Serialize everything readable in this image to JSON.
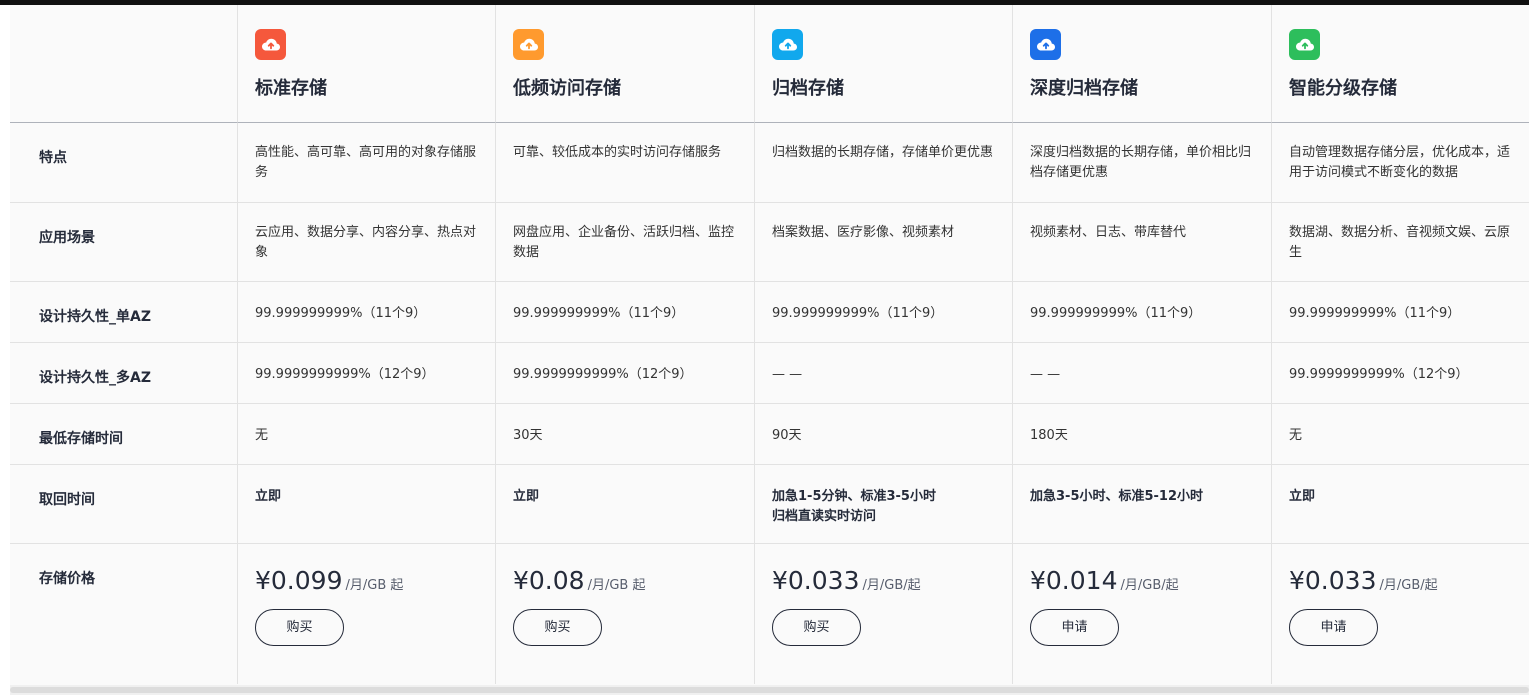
{
  "products": [
    {
      "name": "标准存储",
      "icon": "cloud-upload-icon",
      "color": "#f5583c"
    },
    {
      "name": "低频访问存储",
      "icon": "cloud-upload-icon",
      "color": "#ff9a2e"
    },
    {
      "name": "归档存储",
      "icon": "cloud-upload-icon",
      "color": "#11a8ed"
    },
    {
      "name": "深度归档存储",
      "icon": "cloud-upload-icon",
      "color": "#1d6fe8"
    },
    {
      "name": "智能分级存储",
      "icon": "cloud-upload-icon",
      "color": "#2dbe5c"
    }
  ],
  "rows": [
    {
      "label": "特点",
      "values": [
        "高性能、高可靠、高可用的对象存储服务",
        "可靠、较低成本的实时访问存储服务",
        "归档数据的长期存储，存储单价更优惠",
        "深度归档数据的长期存储，单价相比归档存储更优惠",
        "自动管理数据存储分层，优化成本，适用于访问模式不断变化的数据"
      ]
    },
    {
      "label": "应用场景",
      "values": [
        "云应用、数据分享、内容分享、热点对象",
        "网盘应用、企业备份、活跃归档、监控数据",
        "档案数据、医疗影像、视频素材",
        "视频素材、日志、带库替代",
        "数据湖、数据分析、音视频文娱、云原生"
      ]
    },
    {
      "label": "设计持久性_单AZ",
      "values": [
        "99.999999999%（11个9）",
        "99.999999999%（11个9）",
        "99.999999999%（11个9）",
        "99.999999999%（11个9）",
        "99.999999999%（11个9）"
      ]
    },
    {
      "label": "设计持久性_多AZ",
      "values": [
        "99.9999999999%（12个9）",
        "99.9999999999%（12个9）",
        "— —",
        "— —",
        "99.9999999999%（12个9）"
      ]
    },
    {
      "label": "最低存储时间",
      "values": [
        "无",
        "30天",
        "90天",
        "180天",
        "无"
      ]
    },
    {
      "label": "取回时间",
      "values": [
        "立即",
        "立即",
        "加急1-5分钟、标准3-5小时\n归档直读实时访问",
        "加急3-5小时、标准5-12小时",
        "立即"
      ]
    }
  ],
  "price_row": {
    "label": "存储价格",
    "items": [
      {
        "amount": "¥0.099",
        "unit": "/月/GB 起",
        "button": "购买"
      },
      {
        "amount": "¥0.08",
        "unit": "/月/GB 起",
        "button": "购买"
      },
      {
        "amount": "¥0.033",
        "unit": "/月/GB/起",
        "button": "购买"
      },
      {
        "amount": "¥0.014",
        "unit": "/月/GB/起",
        "button": "申请"
      },
      {
        "amount": "¥0.033",
        "unit": "/月/GB/起",
        "button": "申请"
      }
    ]
  }
}
